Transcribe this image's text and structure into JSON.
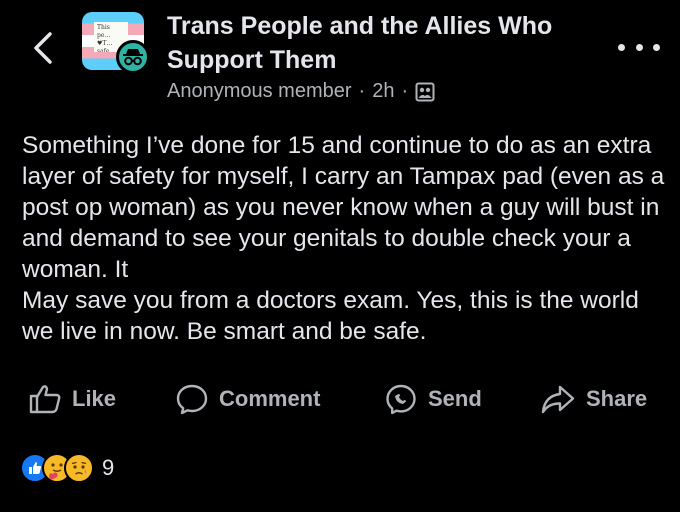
{
  "group": {
    "name": "Trans People and the Allies Who Support Them",
    "avatar_note_text": "This pe… ♥T… safe"
  },
  "meta": {
    "author": "Anonymous member",
    "separator": "·",
    "time": "2h",
    "audience_icon": "group-audience-icon"
  },
  "post": {
    "text": "Something I’ve done for 15 and continue to do as an extra layer of safety for myself, I carry an Tampax pad (even as a post op woman) as you never know when a guy will bust in and demand to see your genitals to double check your a woman. It\nMay save you from a doctors exam. Yes, this is the world we live in now. Be smart and be safe."
  },
  "actions": {
    "like": "Like",
    "comment": "Comment",
    "send": "Send",
    "share": "Share"
  },
  "reactions": {
    "types": [
      "like",
      "care",
      "sad"
    ],
    "count": "9"
  },
  "colors": {
    "background": "#000000",
    "text_primary": "#e4e6eb",
    "text_secondary": "#b0b3b8",
    "like_blue": "#1877f2",
    "reaction_yellow": "#f7b928"
  }
}
